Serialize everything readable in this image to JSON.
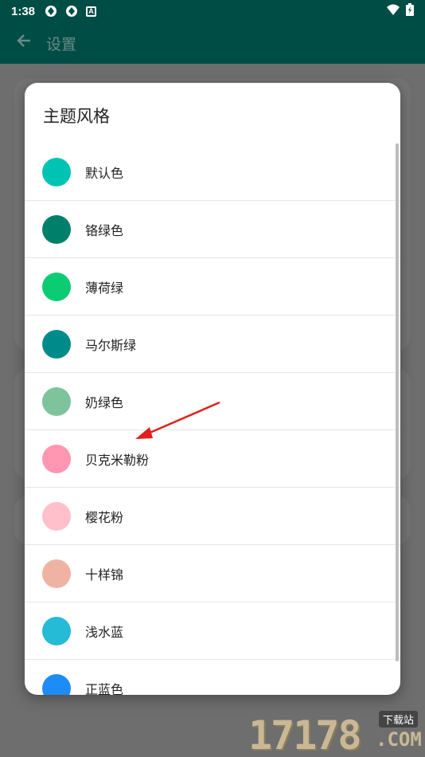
{
  "status_bar": {
    "time": "1:38",
    "icons": [
      "sync-icon",
      "sync-icon",
      "a-box-icon"
    ],
    "right_icons": [
      "wifi-icon",
      "battery-icon"
    ]
  },
  "app_bar": {
    "back_icon": "arrow-left-icon",
    "title": "设置",
    "color": "#004d46"
  },
  "dialog": {
    "title": "主题风格",
    "items": [
      {
        "label": "默认色",
        "color": "#00c4b3"
      },
      {
        "label": "铬绿色",
        "color": "#00806b"
      },
      {
        "label": "薄荷绿",
        "color": "#0ccc73"
      },
      {
        "label": "马尔斯绿",
        "color": "#008b8b"
      },
      {
        "label": "奶绿色",
        "color": "#7ec39c"
      },
      {
        "label": "贝克米勒粉",
        "color": "#ff97b2"
      },
      {
        "label": "樱花粉",
        "color": "#ffc0cb"
      },
      {
        "label": "十样锦",
        "color": "#f0b3a3"
      },
      {
        "label": "浅水蓝",
        "color": "#25bad6"
      },
      {
        "label": "正蓝色",
        "color": "#1e8cf7"
      }
    ]
  },
  "annotation": {
    "color": "#e0201c"
  },
  "watermark": {
    "digits": "17178",
    "tag": "下载站",
    "domain": ".COM"
  }
}
